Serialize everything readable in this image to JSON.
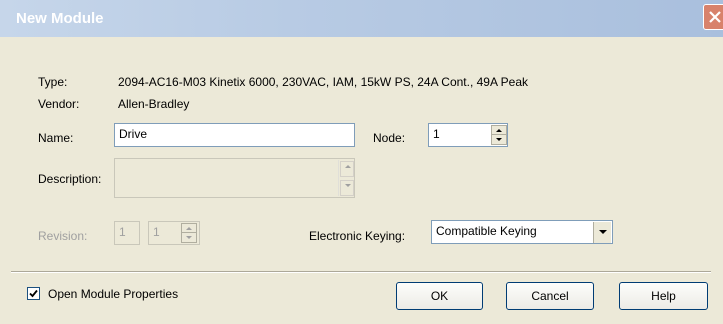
{
  "window": {
    "title": "New Module",
    "close_icon": "close-icon",
    "title_bar_color": "#b8cbe4"
  },
  "form": {
    "type_label": "Type:",
    "type_value": "2094-AC16-M03 Kinetix 6000, 230VAC, IAM, 15kW PS, 24A Cont., 49A Peak",
    "vendor_label": "Vendor:",
    "vendor_value": "Allen-Bradley",
    "name_label": "Name:",
    "name_value": "Drive",
    "node_label": "Node:",
    "node_value": "1",
    "description_label": "Description:",
    "description_value": "",
    "revision_label": "Revision:",
    "revision_major": "1",
    "revision_minor": "1",
    "keying_label": "Electronic Keying:",
    "keying_value": "Compatible Keying"
  },
  "footer": {
    "open_props_label": "Open Module Properties",
    "open_props_checked": true,
    "ok_label": "OK",
    "cancel_label": "Cancel",
    "help_label": "Help"
  }
}
